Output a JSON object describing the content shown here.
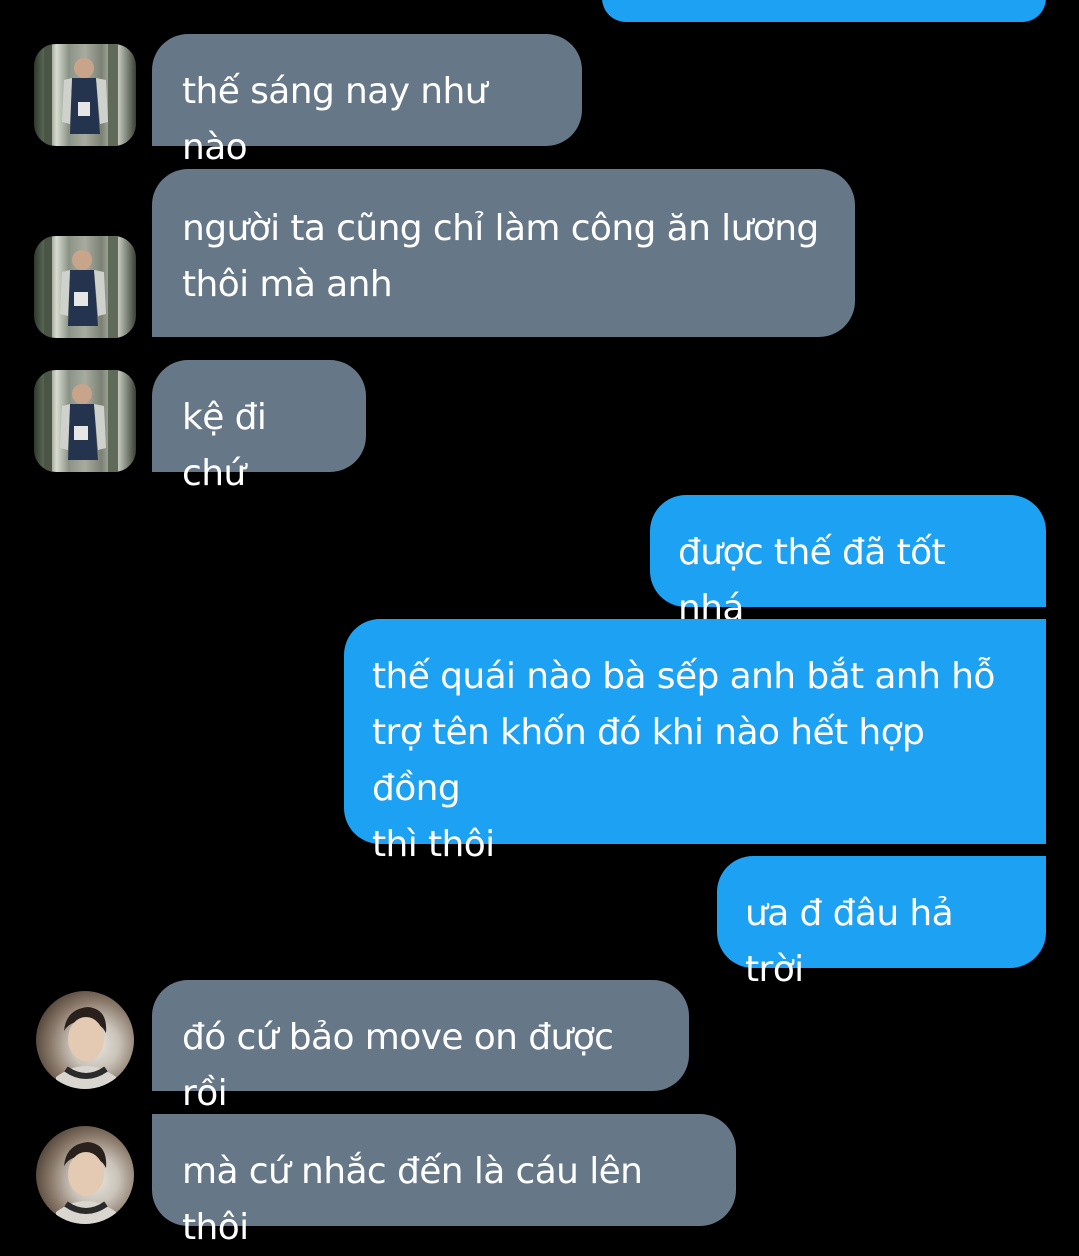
{
  "messages": [
    {
      "side": "out",
      "text": ""
    },
    {
      "side": "in",
      "text": "thế sáng nay như nào"
    },
    {
      "side": "in",
      "text": "người ta cũng chỉ làm công ăn lương\nthôi mà anh"
    },
    {
      "side": "in",
      "text": "kệ đi chứ"
    },
    {
      "side": "out",
      "text": "được thế đã tốt nhá"
    },
    {
      "side": "out",
      "text": "thế quái nào bà sếp anh bắt anh hỗ\ntrợ tên khốn đó khi nào hết hợp đồng\nthì thôi"
    },
    {
      "side": "out",
      "text": "ưa đ đâu hả trời"
    },
    {
      "side": "in",
      "text": "đó cứ bảo move on được rồi"
    },
    {
      "side": "in",
      "text": "mà cứ nhắc đến là cáu lên thôi"
    }
  ],
  "colors": {
    "background": "#000000",
    "incoming_bubble": "#667788",
    "outgoing_bubble": "#1da1f2",
    "text": "#ffffff"
  },
  "icons": {
    "contact_avatar_1": "profile-photo-jersey-12",
    "contact_avatar_2": "profile-photo-headphones"
  }
}
